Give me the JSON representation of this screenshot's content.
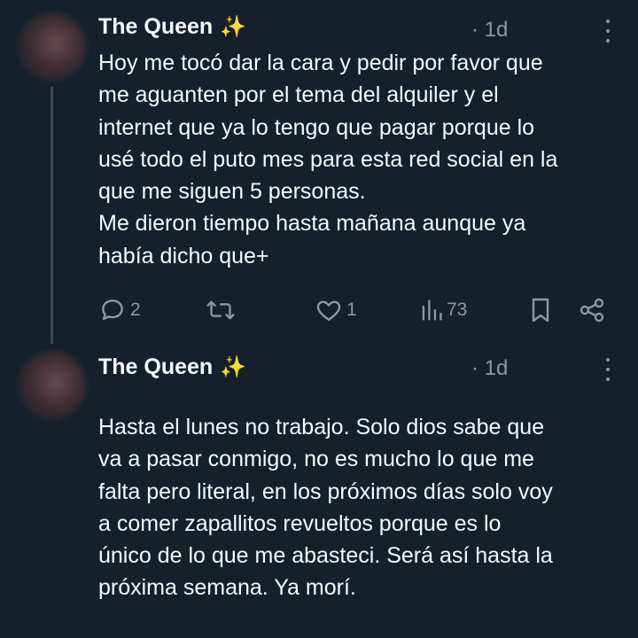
{
  "tweets": [
    {
      "author": "The Queen",
      "author_emoji": "✨",
      "time": "· 1d",
      "lines": [
        "Hoy me tocó dar la cara y pedir por favor que",
        "me aguanten por el tema del alquiler y el",
        "internet que ya lo tengo que pagar porque lo",
        "usé todo el puto mes para esta red social en la",
        "que me siguen 5 personas.",
        "Me dieron tiempo hasta mañana aunque ya",
        "había dicho que+"
      ],
      "actions": {
        "replies": "2",
        "retweets": "",
        "likes": "1",
        "views": "73"
      },
      "icons": [
        "reply-icon",
        "retweet-icon",
        "like-icon",
        "views-icon",
        "bookmark-icon",
        "share-icon",
        "more-icon"
      ]
    },
    {
      "author": "The Queen",
      "author_emoji": "✨",
      "time": "· 1d",
      "lines": [
        "Hasta el lunes no trabajo. Solo dios sabe que",
        "va a pasar conmigo, no es mucho lo que me",
        "falta pero literal, en los próximos días solo voy",
        "a comer zapallitos revueltos porque es lo",
        "único de lo que me abasteci. Será así hasta la",
        "próxima semana. Ya morí."
      ]
    }
  ],
  "colors": {
    "background": "#15202b",
    "text": "#f7f9f9",
    "muted": "#8b98a5",
    "thread_line": "#3d4a57"
  }
}
